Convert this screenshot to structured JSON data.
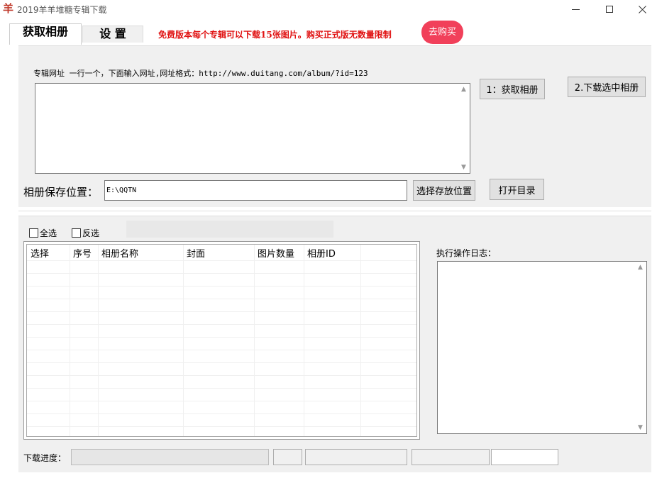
{
  "window": {
    "title": "2019羊羊堆糖专辑下载",
    "icon_glyph": "羊",
    "controls": {
      "minimize": "—",
      "maximize": "☐",
      "close": "✕"
    }
  },
  "tabs": [
    {
      "label": "获取相册",
      "active": true
    },
    {
      "label": "设 置",
      "active": false
    }
  ],
  "promo": {
    "text": "免费版本每个专辑可以下载15张图片。购买正式版无数量限制",
    "buy_label": "去购买"
  },
  "upper": {
    "url_hint": "专辑网址 一行一个，下面输入网址,网址格式：http://www.duitang.com/album/?id=123",
    "url_value": "",
    "fetch_label": "1：获取相册",
    "download_label": "2.下载选中相册",
    "save_label": "相册保存位置：",
    "save_path": "E:\\QQTN",
    "choose_location_label": "选择存放位置",
    "open_dir_label": "打开目录"
  },
  "selection": {
    "select_all": "全选",
    "invert": "反选"
  },
  "table": {
    "columns": [
      "选择",
      "序号",
      "相册名称",
      "封面",
      "图片数量",
      "相册ID"
    ],
    "rows": []
  },
  "log": {
    "label": "执行操作日志："
  },
  "progress": {
    "label": "下载进度：",
    "value": 0,
    "status": [
      "",
      "",
      "",
      ""
    ]
  },
  "colors": {
    "promo_text": "#e01010",
    "buy_button": "#f1405a",
    "panel_bg": "#f0f0f0"
  }
}
